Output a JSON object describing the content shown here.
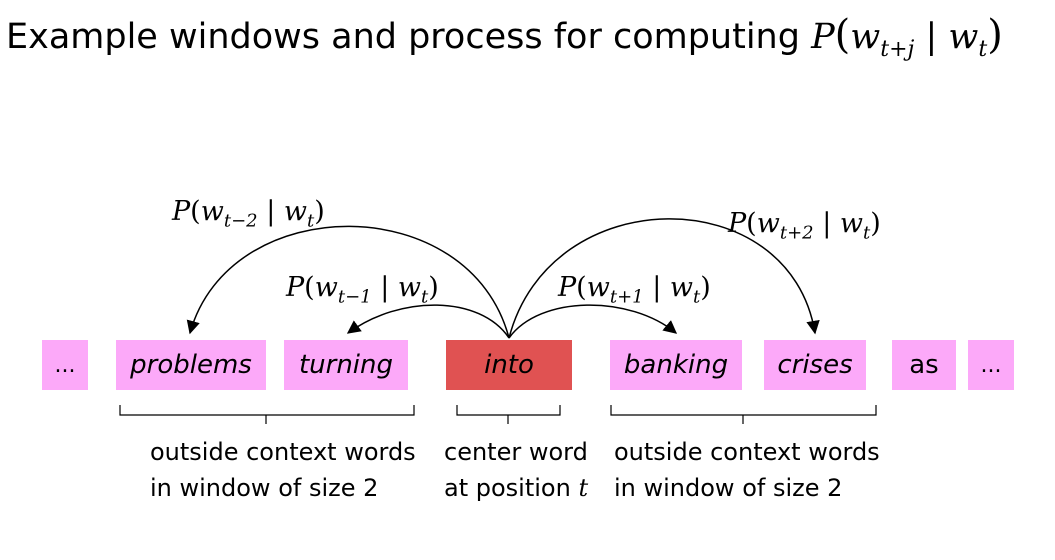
{
  "title": {
    "text": "Example windows and process for computing ",
    "P": "P",
    "w1": "w",
    "sub1": "t+j",
    "bar": "|",
    "w2": "w",
    "sub2": "t"
  },
  "words": {
    "dots_left": "...",
    "problems": "problems",
    "turning": "turning",
    "into": "into",
    "banking": "banking",
    "crises": "crises",
    "as": "as",
    "dots_right": "..."
  },
  "probs": {
    "tm2": {
      "P": "P",
      "w": "w",
      "sub": "t−2",
      "bar": "|",
      "w2": "w",
      "sub2": "t"
    },
    "tm1": {
      "P": "P",
      "w": "w",
      "sub": "t−1",
      "bar": "|",
      "w2": "w",
      "sub2": "t"
    },
    "tp1": {
      "P": "P",
      "w": "w",
      "sub": "t+1",
      "bar": "|",
      "w2": "w",
      "sub2": "t"
    },
    "tp2": {
      "P": "P",
      "w": "w",
      "sub": "t+2",
      "bar": "|",
      "w2": "w",
      "sub2": "t"
    }
  },
  "labels": {
    "left_line1": "outside context words",
    "left_line2": "in window of size 2",
    "center_line1": "center word",
    "center_line2_a": "at position ",
    "center_line2_t": "t",
    "right_line1": "outside context words",
    "right_line2": "in window of size 2"
  },
  "colors": {
    "context_box": "#fca9f9",
    "center_box": "#e05252"
  }
}
